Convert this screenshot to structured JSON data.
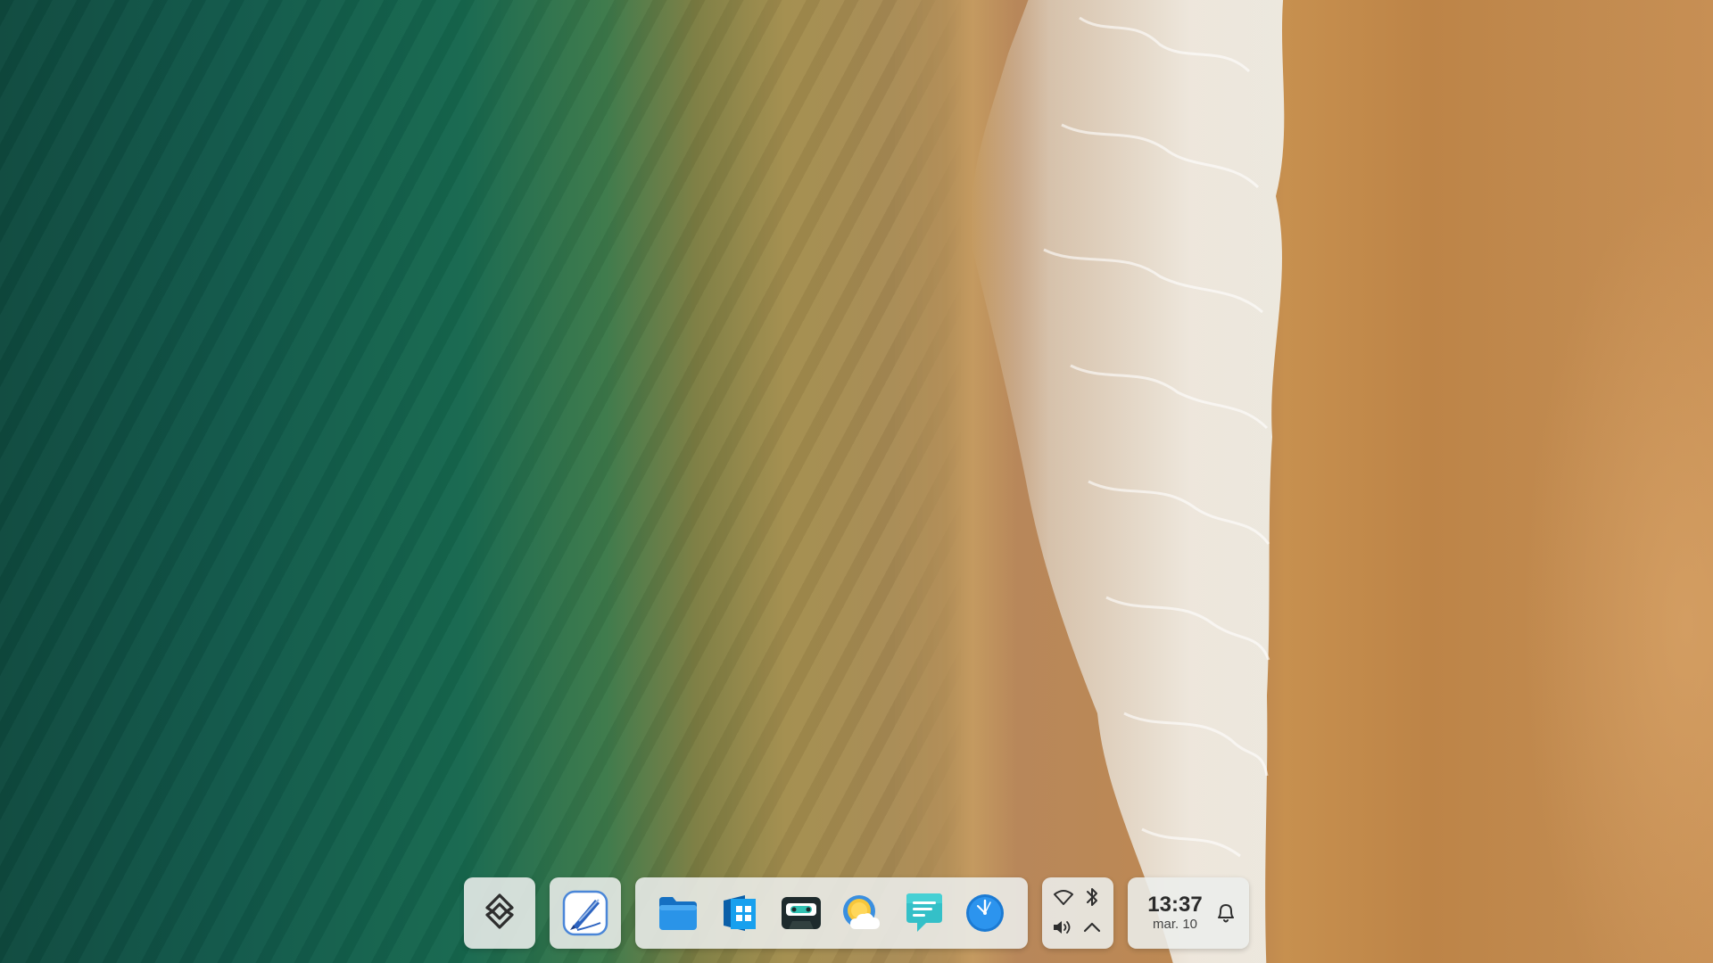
{
  "wallpaper": {
    "name": "wallpaper",
    "colors": {
      "sea": "#11584a",
      "shallows": "#a48e4e",
      "foam": "#f4f6f4",
      "sand": "#c18a4f"
    }
  },
  "taskbar": {
    "launcher": {
      "icon": "launcher-icon"
    },
    "pinned": {
      "icon": "inkscape-pen-icon"
    },
    "apps": [
      {
        "id": "files",
        "icon": "folder-icon",
        "accent": "#1e8ce0"
      },
      {
        "id": "software",
        "icon": "app-store-icon",
        "accent": "#0a7fd0"
      },
      {
        "id": "media",
        "icon": "cassette-icon",
        "accent": "#2ab7a9"
      },
      {
        "id": "weather",
        "icon": "weather-sun-cloud-icon",
        "accent": "#f6c23a"
      },
      {
        "id": "chat",
        "icon": "chat-bubble-icon",
        "accent": "#38c3c9"
      },
      {
        "id": "clock",
        "icon": "clock-icon",
        "accent": "#2b8ee6"
      }
    ],
    "tray": {
      "wifi": "wifi-icon",
      "bluetooth": "bluetooth-icon",
      "volume": "volume-icon",
      "expand": "chevron-up-icon"
    },
    "clock": {
      "time": "13:37",
      "date": "mar. 10"
    },
    "notifications": "bell-icon"
  }
}
